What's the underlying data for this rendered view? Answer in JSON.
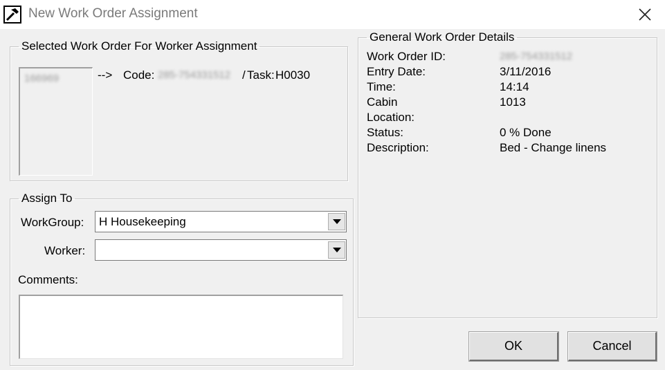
{
  "window": {
    "title": "New Work Order Assignment"
  },
  "selected": {
    "legend": "Selected Work Order For Worker Assignment",
    "list_item": "166969",
    "arrow": "-->",
    "code_label": "Code:",
    "code_value": "285-754331512",
    "slash": "/",
    "task_label": "Task:",
    "task_value": "H0030"
  },
  "assign": {
    "legend": "Assign To",
    "workgroup_label": "WorkGroup:",
    "workgroup_value": "H Housekeeping",
    "worker_label": "Worker:",
    "worker_value": "",
    "comments_label": "Comments:",
    "comments_value": ""
  },
  "details": {
    "legend": "General Work Order Details",
    "rows": [
      {
        "label": "Work Order ID:",
        "value": "285-754331512"
      },
      {
        "label": "Entry Date:",
        "value": "3/11/2016"
      },
      {
        "label": "Time:",
        "value": "14:14"
      },
      {
        "label": "Cabin",
        "value": "1013"
      },
      {
        "label": "Location:",
        "value": ""
      },
      {
        "label": "Status:",
        "value": "0 % Done"
      },
      {
        "label": "Description:",
        "value": "Bed - Change linens"
      }
    ]
  },
  "buttons": {
    "ok": "OK",
    "cancel": "Cancel"
  },
  "icons": {
    "app": "hammer-icon",
    "close": "close-icon",
    "dropdown": "chevron-down-icon"
  }
}
